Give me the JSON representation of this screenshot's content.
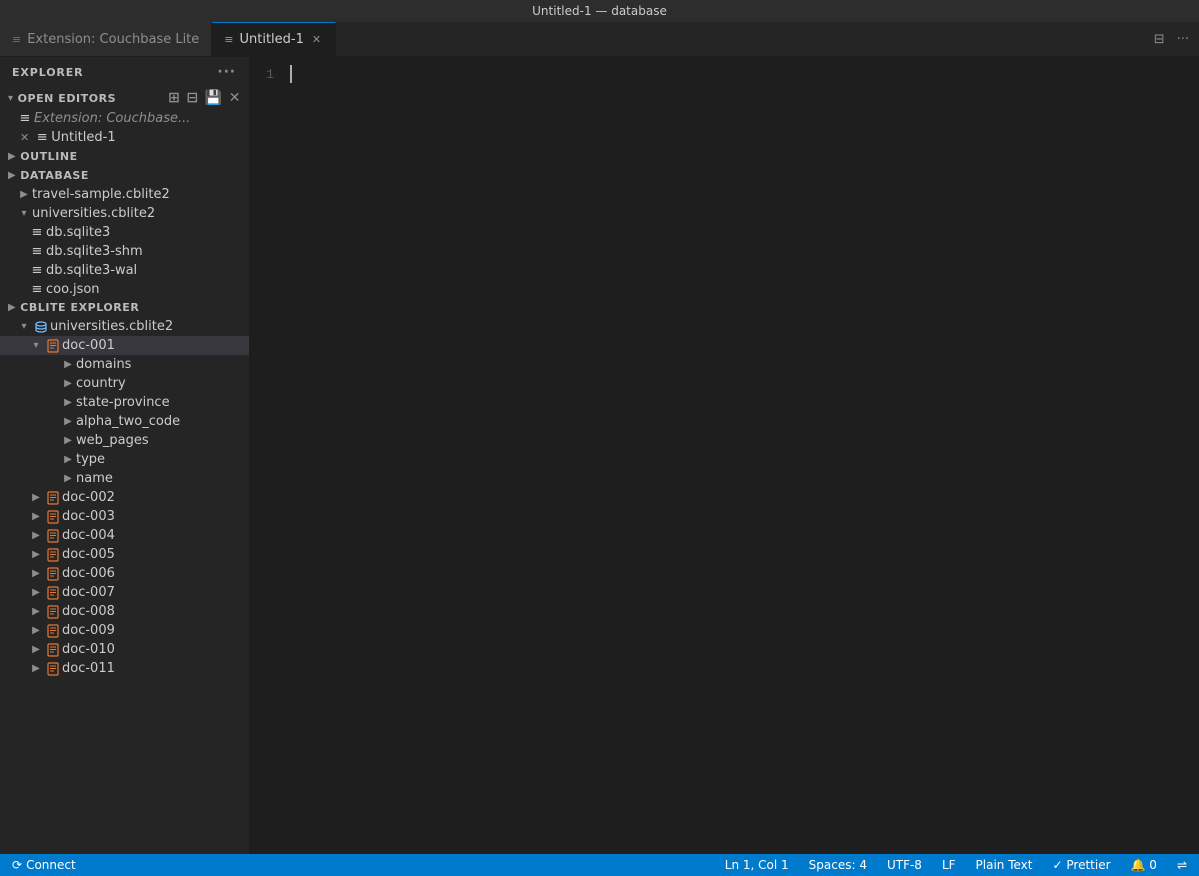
{
  "titleBar": {
    "title": "Untitled-1 — database"
  },
  "tabs": [
    {
      "id": "tab-extension",
      "label": "Extension: Couchbase Lite",
      "icon": "≡",
      "active": false,
      "closeable": false
    },
    {
      "id": "tab-untitled",
      "label": "Untitled-1",
      "icon": "≡",
      "active": true,
      "closeable": true
    }
  ],
  "tabBarIcons": {
    "splitIcon": "⊟",
    "moreIcon": "···"
  },
  "sidebar": {
    "header": "EXPLORER",
    "moreIcon": "···",
    "sections": {
      "openEditors": {
        "label": "OPEN EDITORS",
        "icons": [
          "new-file",
          "new-folder",
          "save-all",
          "close-all"
        ],
        "items": [
          {
            "label": "Extension: Couchbase...",
            "icon": "≡",
            "closeable": false
          },
          {
            "label": "Untitled-1",
            "icon": "≡",
            "closeable": true
          }
        ]
      },
      "outline": {
        "label": "OUTLINE"
      },
      "database": {
        "label": "DATABASE",
        "items": [
          {
            "label": "travel-sample.cblite2",
            "type": "folder",
            "expanded": false
          },
          {
            "label": "universities.cblite2",
            "type": "folder",
            "expanded": true,
            "children": [
              {
                "label": "db.sqlite3",
                "icon": "file"
              },
              {
                "label": "db.sqlite3-shm",
                "icon": "file"
              },
              {
                "label": "db.sqlite3-wal",
                "icon": "file"
              },
              {
                "label": "coo.json",
                "icon": "file"
              }
            ]
          }
        ]
      },
      "cbliteExplorer": {
        "label": "CBLITE EXPLORER",
        "items": [
          {
            "label": "universities.cblite2",
            "type": "db",
            "expanded": true,
            "children": [
              {
                "label": "doc-001",
                "type": "doc",
                "expanded": true,
                "selected": true,
                "children": [
                  {
                    "label": "domains",
                    "type": "field",
                    "expandable": true
                  },
                  {
                    "label": "country",
                    "type": "field",
                    "expandable": true
                  },
                  {
                    "label": "state-province",
                    "type": "field",
                    "expandable": true
                  },
                  {
                    "label": "alpha_two_code",
                    "type": "field",
                    "expandable": true
                  },
                  {
                    "label": "web_pages",
                    "type": "field",
                    "expandable": true
                  },
                  {
                    "label": "type",
                    "type": "field",
                    "expandable": true
                  },
                  {
                    "label": "name",
                    "type": "field",
                    "expandable": true
                  }
                ]
              },
              {
                "label": "doc-002",
                "type": "doc",
                "expanded": false
              },
              {
                "label": "doc-003",
                "type": "doc",
                "expanded": false
              },
              {
                "label": "doc-004",
                "type": "doc",
                "expanded": false
              },
              {
                "label": "doc-005",
                "type": "doc",
                "expanded": false
              },
              {
                "label": "doc-006",
                "type": "doc",
                "expanded": false
              },
              {
                "label": "doc-007",
                "type": "doc",
                "expanded": false
              },
              {
                "label": "doc-008",
                "type": "doc",
                "expanded": false
              },
              {
                "label": "doc-009",
                "type": "doc",
                "expanded": false
              },
              {
                "label": "doc-010",
                "type": "doc",
                "expanded": false
              },
              {
                "label": "doc-011",
                "type": "doc",
                "expanded": false
              }
            ]
          }
        ]
      }
    }
  },
  "editor": {
    "lineNumber": "1",
    "content": ""
  },
  "statusBar": {
    "left": {
      "connectIcon": "⟳",
      "connectLabel": "Connect"
    },
    "right": {
      "position": "Ln 1, Col 1",
      "spaces": "Spaces: 4",
      "encoding": "UTF-8",
      "lineEnding": "LF",
      "language": "Plain Text",
      "prettierIcon": "✓",
      "prettierLabel": "Prettier",
      "notifyIcon": "🔔",
      "notifyCount": "0",
      "remoteIcon": "⇌"
    }
  }
}
